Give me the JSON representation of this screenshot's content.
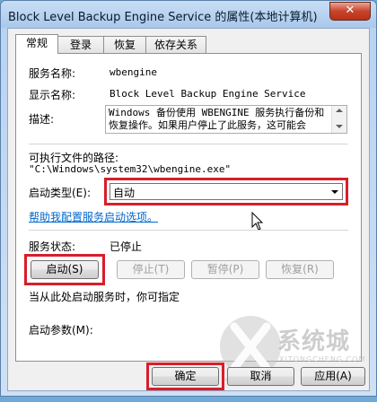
{
  "window": {
    "title": "Block Level Backup Engine Service 的属性(本地计算机)",
    "close_glyph": "✕"
  },
  "tabs": [
    {
      "label": "常规"
    },
    {
      "label": "登录"
    },
    {
      "label": "恢复"
    },
    {
      "label": "依存关系"
    }
  ],
  "general": {
    "service_name_label": "服务名称:",
    "service_name": "wbengine",
    "display_name_label": "显示名称:",
    "display_name": "Block Level Backup Engine Service",
    "description_label": "描述:",
    "description": "Windows 备份使用 WBENGINE 服务执行备份和恢复操作。如果用户停止了此服务，这可能会",
    "exe_path_label": "可执行文件的路径:",
    "exe_path": "\"C:\\Windows\\system32\\wbengine.exe\"",
    "startup_type_label": "启动类型(E):",
    "startup_type_value": "自动",
    "help_link": "帮助我配置服务启动选项。",
    "status_label": "服务状态:",
    "status_value": "已停止",
    "start_button": "启动(S)",
    "stop_button": "停止(T)",
    "pause_button": "暂停(P)",
    "resume_button": "恢复(R)",
    "start_hint": "当从此处启动服务时，你可指定",
    "start_params_label": "启动参数(M):"
  },
  "footer": {
    "ok_button": "确定",
    "cancel_button": "取消",
    "apply_button": "应用(A)"
  },
  "watermark": {
    "text": "系统城",
    "subtext": "XITONGCHENG.COM"
  },
  "colors": {
    "highlight": "#d81e2a",
    "link": "#0066cc"
  }
}
